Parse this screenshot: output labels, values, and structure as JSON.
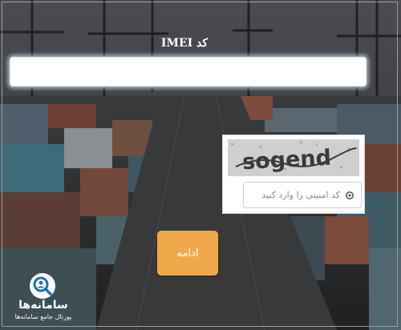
{
  "imei": {
    "label": "کد IMEI",
    "value": "",
    "placeholder": ""
  },
  "captcha": {
    "image_text": "sogend",
    "placeholder": "کد امنیتی را وارد کنید",
    "refresh_icon": "refresh-icon"
  },
  "form": {
    "continue_label": "ادامه"
  },
  "brand": {
    "name": "سامانه‌ها",
    "tagline": "پورتال جامع سامانه‌ها",
    "icon": "magnifier-person-icon"
  },
  "colors": {
    "accent_button": "#efa94a",
    "input_glow": "#d2e1f5",
    "logo_blue": "#1b6fc0"
  }
}
